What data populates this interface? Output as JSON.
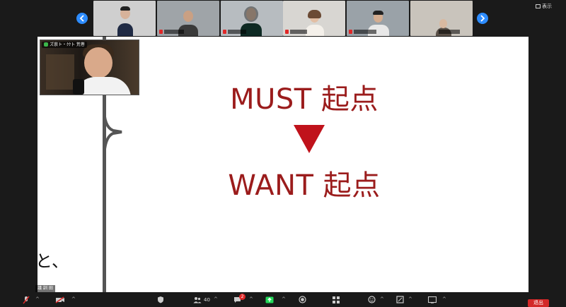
{
  "strip": {
    "show_label": "表示",
    "participant_count": 6
  },
  "self_view": {
    "name_label": "ズ崇ト・ｸｸ卜 荒巻"
  },
  "bottom_overlay": {
    "label": "議 訓 田"
  },
  "slide": {
    "line1": "MUST 起点",
    "line2": "WANT 起点",
    "bottom_text": "と、",
    "accent_color": "#9b1c1c",
    "arrow_color": "#c0121b"
  },
  "toolbar": {
    "participants_count": "40",
    "chat_badge": "2",
    "leave_label": "退出"
  },
  "icons": {
    "prev": "chevron-left-icon",
    "next": "chevron-right-icon",
    "mic": "mic-muted-icon",
    "video": "video-off-icon",
    "security": "shield-icon",
    "participants": "people-icon",
    "chat": "chat-icon",
    "share": "share-screen-icon",
    "record": "record-icon",
    "apps": "apps-icon",
    "reactions": "reaction-icon",
    "more": "more-icon",
    "view": "view-icon"
  }
}
